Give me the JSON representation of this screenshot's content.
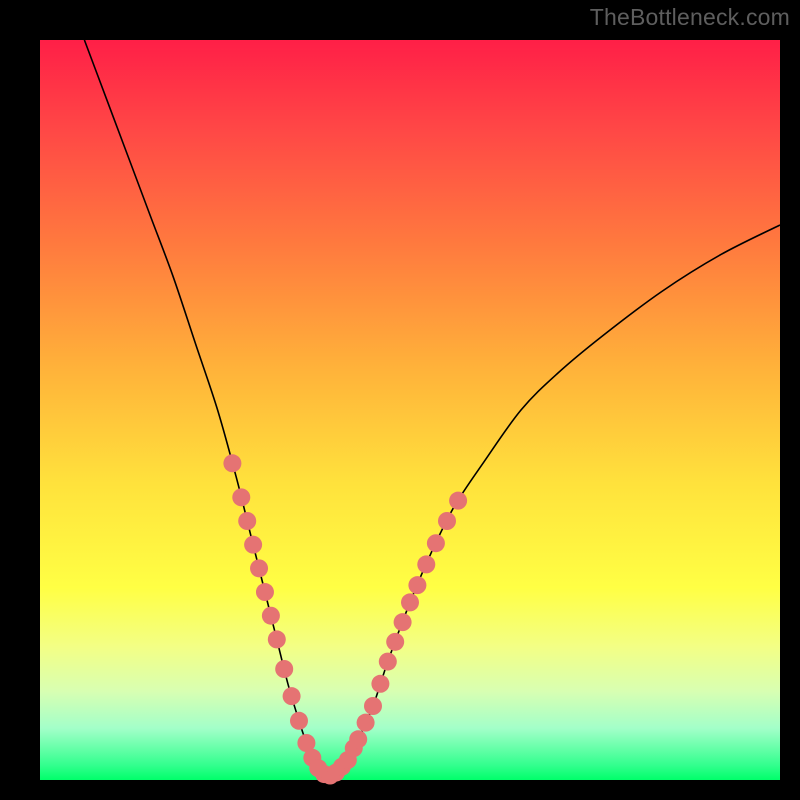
{
  "watermark": "TheBottleneck.com",
  "colors": {
    "background": "#000000",
    "curve": "#000000",
    "marker": "#e57373",
    "gradient_top": "#ff1f47",
    "gradient_bottom": "#00ff6a"
  },
  "chart_data": {
    "type": "line",
    "title": "",
    "xlabel": "",
    "ylabel": "",
    "xlim": [
      0,
      100
    ],
    "ylim": [
      0,
      100
    ],
    "grid": false,
    "legend": false,
    "series": [
      {
        "name": "bottleneck-curve",
        "x": [
          6,
          9,
          12,
          15,
          18,
          21,
          24,
          26.5,
          28.5,
          30.5,
          32,
          33.5,
          35,
          36,
          37,
          38,
          39,
          40,
          41.5,
          43,
          45,
          47,
          50,
          53,
          56,
          60,
          65,
          70,
          76,
          84,
          92,
          100
        ],
        "y": [
          100,
          92,
          84,
          76,
          68,
          59,
          50,
          41,
          33,
          25,
          19,
          13,
          8,
          5,
          2.5,
          1,
          0.5,
          1,
          2.5,
          5.5,
          10,
          16,
          24,
          31,
          37,
          43,
          50,
          55,
          60,
          66,
          71,
          75
        ]
      }
    ],
    "markers": {
      "left_band": {
        "x": [
          26.0,
          27.2,
          28.0,
          28.8,
          29.6,
          30.4,
          31.2,
          32.0,
          33.0,
          34.0,
          35.0
        ],
        "radius": 9
      },
      "floor_band": {
        "x": [
          36.0,
          36.8,
          37.6,
          38.4,
          39.2,
          40.0,
          40.8,
          41.6,
          42.4,
          43.0
        ],
        "radius": 9
      },
      "right_band": {
        "x": [
          44.0,
          45.0,
          46.0,
          47.0,
          48.0,
          49.0,
          50.0,
          51.0,
          52.2,
          53.5,
          55.0,
          56.5
        ],
        "radius": 9
      }
    },
    "annotations": []
  }
}
